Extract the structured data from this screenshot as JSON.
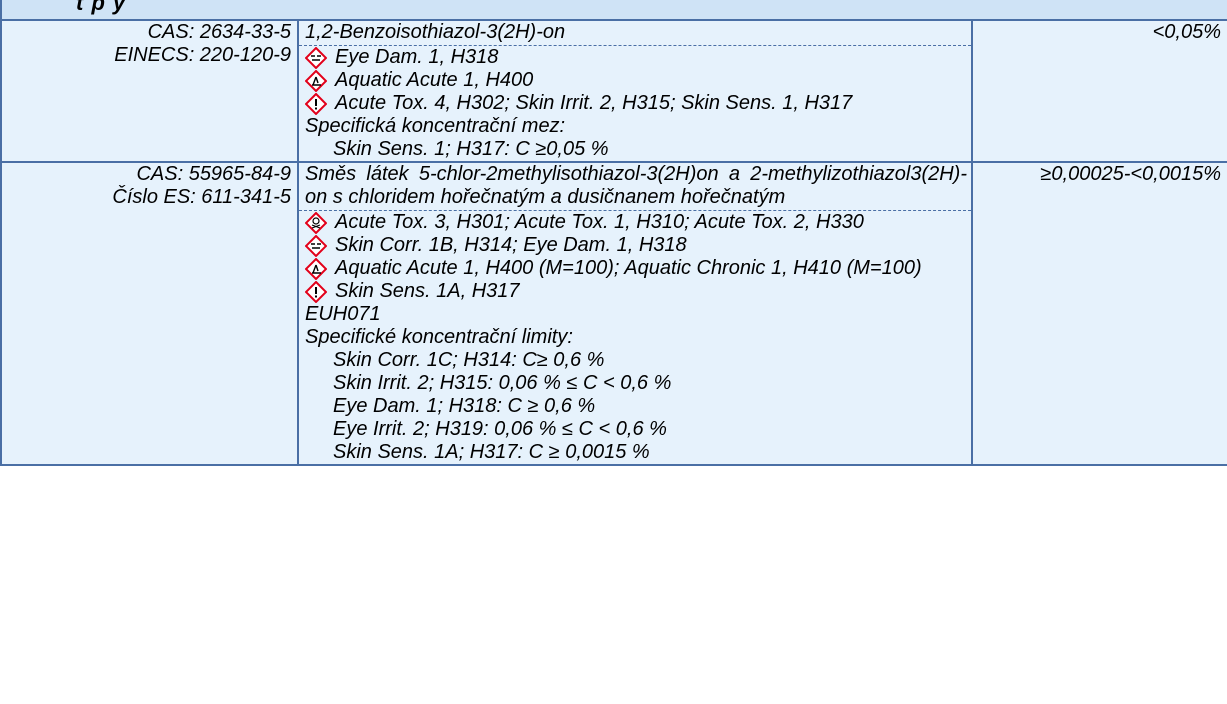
{
  "header_fragment": "t  p    y",
  "rows": [
    {
      "ids": [
        "CAS: 2634-33-5",
        "EINECS: 220-120-9"
      ],
      "name": "1,2-Benzoisothiazol-3(2H)-on",
      "hazards": [
        {
          "icon": "corrosion-pictogram-icon",
          "text": "Eye Dam. 1, H318"
        },
        {
          "icon": "environment-pictogram-icon",
          "text": "Aquatic Acute 1, H400"
        },
        {
          "icon": "exclamation-pictogram-icon",
          "text": "Acute Tox. 4, H302; Skin Irrit. 2, H315; Skin Sens. 1, H317"
        }
      ],
      "limits_heading": "Specifická koncentrační mez:",
      "limits": [
        "Skin Sens. 1; H317: C ≥0,05 %"
      ],
      "concentration": "<0,05%"
    },
    {
      "ids": [
        "CAS: 55965-84-9",
        "Číslo ES: 611-341-5"
      ],
      "name": "Směs látek 5-chlor-2methylisothiazol-3(2H)on a 2-methylizothiazol3(2H)-on s chloridem hořečnatým a dusičnanem hořečnatým",
      "hazards": [
        {
          "icon": "skull-crossbones-pictogram-icon",
          "text": "Acute Tox. 3, H301; Acute Tox. 1, H310; Acute Tox. 2, H330"
        },
        {
          "icon": "corrosion-pictogram-icon",
          "text": "Skin Corr. 1B, H314; Eye Dam. 1, H318"
        },
        {
          "icon": "environment-pictogram-icon",
          "text": "Aquatic Acute 1, H400 (M=100); Aquatic Chronic 1, H410 (M=100)"
        },
        {
          "icon": "exclamation-pictogram-icon",
          "text": "Skin Sens. 1A, H317"
        }
      ],
      "extra": "EUH071",
      "limits_heading": "Specifické koncentrační limity:",
      "limits": [
        "Skin Corr. 1C; H314: C≥ 0,6 %",
        "Skin Irrit. 2; H315: 0,06 % ≤ C < 0,6 %",
        "Eye Dam. 1; H318: C ≥ 0,6 %",
        "Eye Irrit. 2; H319: 0,06 % ≤ C < 0,6 %",
        "Skin Sens. 1A; H317: C ≥ 0,0015 %"
      ],
      "concentration": "≥0,00025-<0,0015%"
    }
  ],
  "colors": {
    "cell_bg": "#e6f2fc",
    "border": "#4a6fa5",
    "pictogram_red": "#e2001a",
    "band": "#cfe3f6"
  }
}
